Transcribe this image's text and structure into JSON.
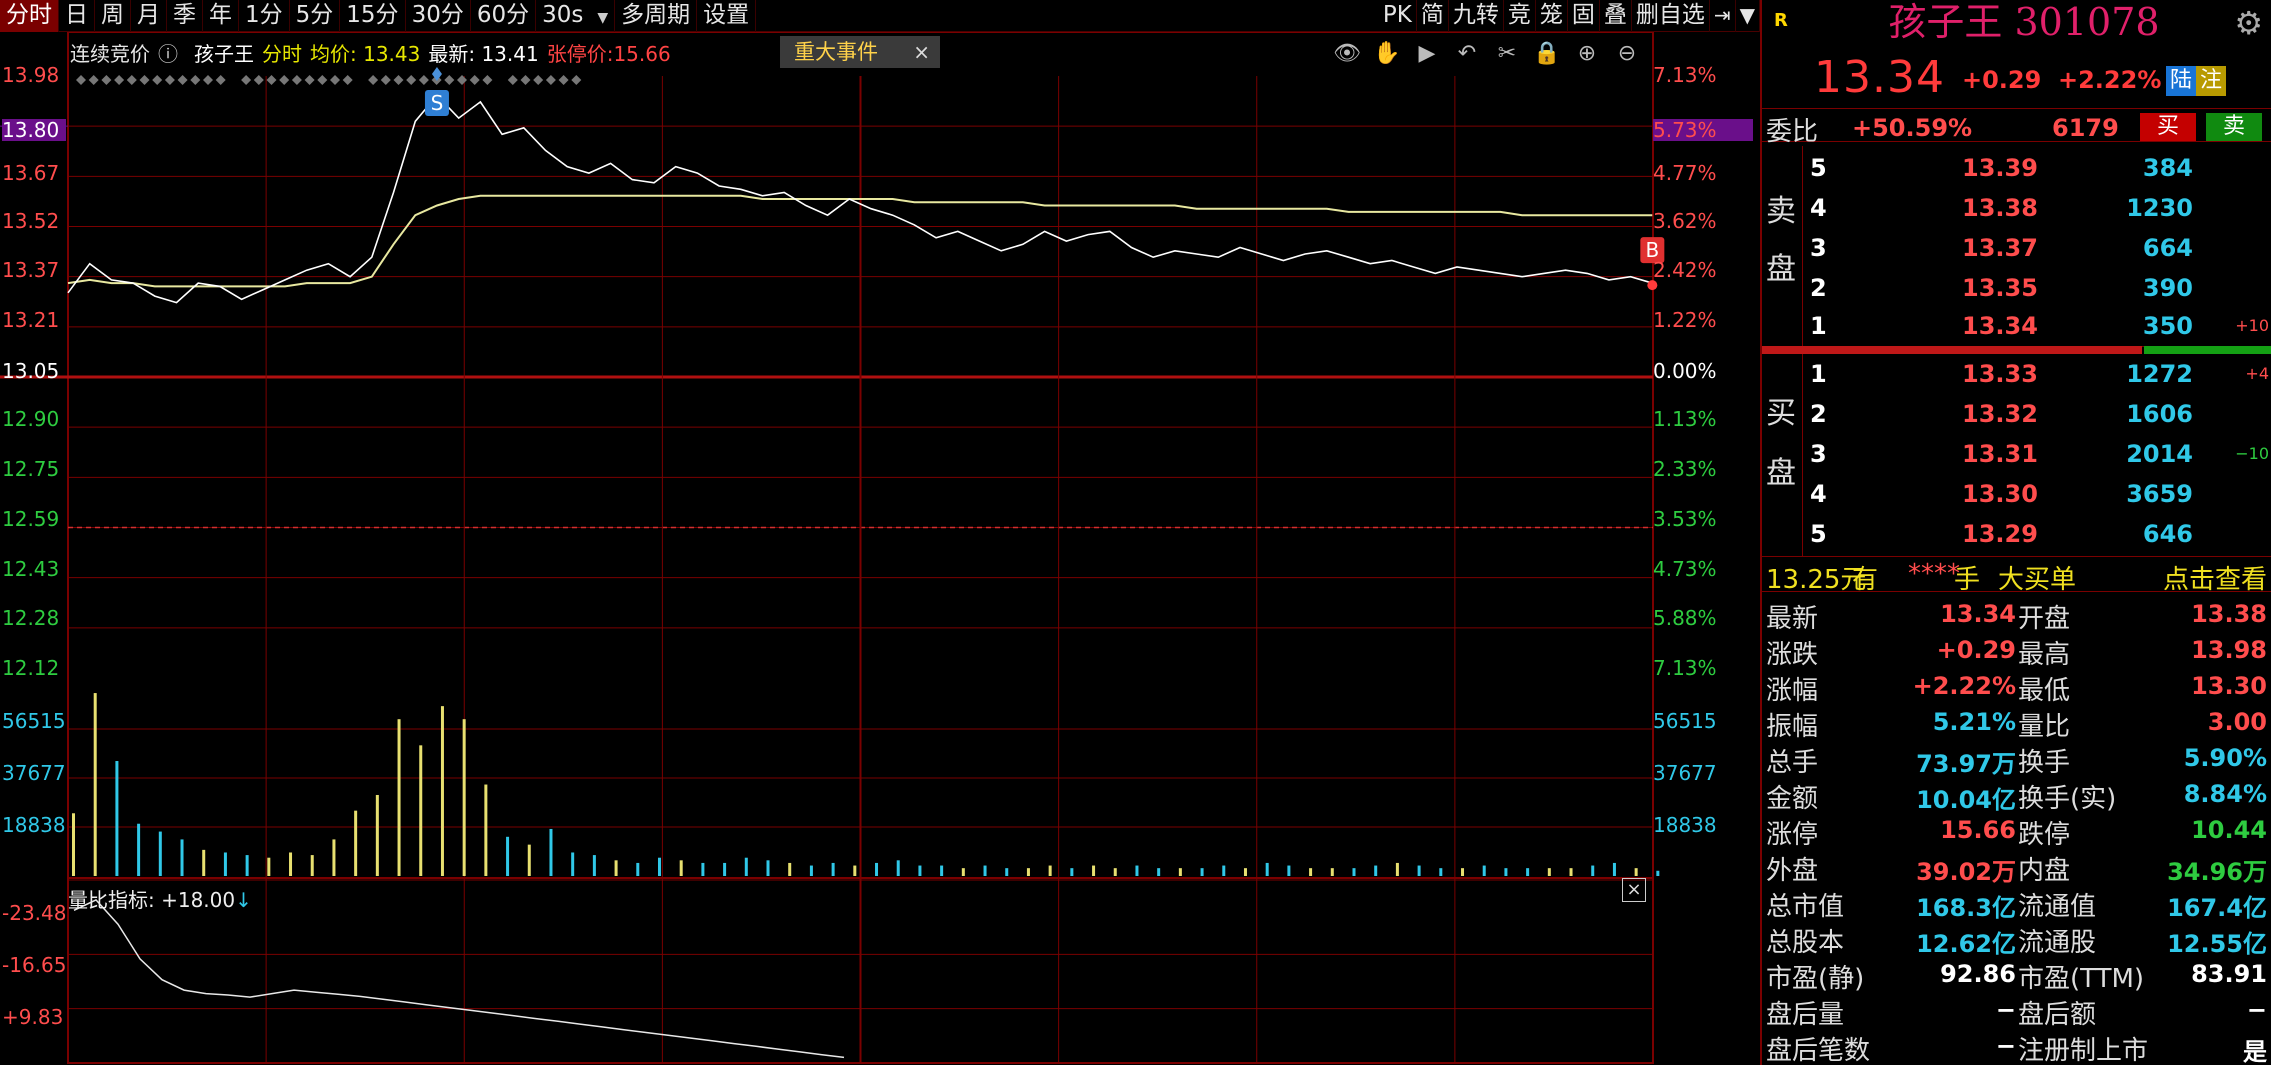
{
  "toolbar": {
    "period_tabs": [
      "分时",
      "日",
      "周",
      "月",
      "季",
      "年",
      "1分",
      "5分",
      "15分",
      "30分",
      "60分"
    ],
    "interval_select": "30s",
    "multi_period": "多周期",
    "settings": "设置",
    "tools": [
      "PK",
      "简",
      "九转",
      "竞",
      "笼",
      "固",
      "叠",
      "删自选"
    ]
  },
  "chart": {
    "info": {
      "auction": "连续竞价",
      "name": "孩子王",
      "mode": "分时",
      "avg": "均价: 13.43",
      "latest": "最新: 13.41",
      "limit_up": "张停价:15.66"
    },
    "event_tag": "重大事件",
    "event_close": "×",
    "tool_icons": [
      "eye-icon",
      "hand-icon",
      "play-icon",
      "undo-icon",
      "scissors-icon",
      "lock-icon",
      "zoom-in-icon",
      "zoom-out-icon"
    ],
    "price_axis_left": [
      "13.98",
      "13.80",
      "13.67",
      "13.52",
      "13.37",
      "13.21",
      "13.05",
      "12.90",
      "12.75",
      "12.59",
      "12.43",
      "12.28",
      "12.12"
    ],
    "price_axis_right": [
      "7.13%",
      "5.73%",
      "4.77%",
      "3.62%",
      "2.42%",
      "1.22%",
      "0.00%",
      "1.13%",
      "2.33%",
      "3.53%",
      "4.73%",
      "5.88%",
      "7.13%"
    ],
    "price_axis_colors": [
      "red",
      "hl",
      "red",
      "red",
      "red",
      "red",
      "white",
      "green",
      "green",
      "green",
      "green",
      "green",
      "green"
    ],
    "volume_axis": [
      "56515",
      "37677",
      "18838"
    ],
    "indicator_label": "量比指标: +18.00",
    "indicator_axis": [
      "-23.48",
      "-16.65",
      "+9.83"
    ],
    "markers": {
      "sell": "S",
      "buy": "B"
    },
    "colors": {
      "up": "#ff4d4d",
      "down": "#2ecc40",
      "grid": "#7a0000",
      "price_line": "#ffffff",
      "avg_line": "#e8e8a0"
    }
  },
  "panel": {
    "r_badge": "R",
    "title": "孩子王 301078",
    "price": "13.34",
    "change": "+0.29",
    "change_pct": "+2.22%",
    "tag1": "陆",
    "tag2": "注",
    "ratio_label": "委比",
    "ratio_value": "+50.59%",
    "ratio_diff": "6179",
    "buy_label": "买",
    "sell_label": "卖",
    "sell_side_label": [
      "卖",
      "盘"
    ],
    "buy_side_label": [
      "买",
      "盘"
    ],
    "asks": [
      {
        "level": "5",
        "price": "13.39",
        "volume": "384",
        "delta": ""
      },
      {
        "level": "4",
        "price": "13.38",
        "volume": "1230",
        "delta": ""
      },
      {
        "level": "3",
        "price": "13.37",
        "volume": "664",
        "delta": ""
      },
      {
        "level": "2",
        "price": "13.35",
        "volume": "390",
        "delta": ""
      },
      {
        "level": "1",
        "price": "13.34",
        "volume": "350",
        "delta": "+10"
      }
    ],
    "bids": [
      {
        "level": "1",
        "price": "13.33",
        "volume": "1272",
        "delta": "+4"
      },
      {
        "level": "2",
        "price": "13.32",
        "volume": "1606",
        "delta": ""
      },
      {
        "level": "3",
        "price": "13.31",
        "volume": "2014",
        "delta": "−10"
      },
      {
        "level": "4",
        "price": "13.30",
        "volume": "3659",
        "delta": ""
      },
      {
        "level": "5",
        "price": "13.29",
        "volume": "646",
        "delta": ""
      }
    ],
    "big_order": {
      "price": "13.25元",
      "have": "有",
      "stars": "****",
      "hand": "手",
      "label": "大买单",
      "link": "点击查看"
    },
    "stats": [
      {
        "l1": "最新",
        "v1": "13.34",
        "c1": "red",
        "l2": "开盘",
        "v2": "13.38",
        "c2": "red"
      },
      {
        "l1": "涨跌",
        "v1": "+0.29",
        "c1": "red",
        "l2": "最高",
        "v2": "13.98",
        "c2": "red"
      },
      {
        "l1": "涨幅",
        "v1": "+2.22%",
        "c1": "red",
        "l2": "最低",
        "v2": "13.30",
        "c2": "red"
      },
      {
        "l1": "振幅",
        "v1": "5.21%",
        "c1": "cyan",
        "l2": "量比",
        "v2": "3.00",
        "c2": "red"
      },
      {
        "l1": "总手",
        "v1": "73.97万",
        "c1": "cyan",
        "l2": "换手",
        "v2": "5.90%",
        "c2": "cyan"
      },
      {
        "l1": "金额",
        "v1": "10.04亿",
        "c1": "cyan",
        "l2": "换手(实)",
        "v2": "8.84%",
        "c2": "cyan"
      },
      {
        "l1": "涨停",
        "v1": "15.66",
        "c1": "red",
        "l2": "跌停",
        "v2": "10.44",
        "c2": "green"
      },
      {
        "l1": "外盘",
        "v1": "39.02万",
        "c1": "red",
        "l2": "内盘",
        "v2": "34.96万",
        "c2": "green"
      },
      {
        "l1": "总市值",
        "v1": "168.3亿",
        "c1": "cyan",
        "l2": "流通值",
        "v2": "167.4亿",
        "c2": "cyan"
      },
      {
        "l1": "总股本",
        "v1": "12.62亿",
        "c1": "cyan",
        "l2": "流通股",
        "v2": "12.55亿",
        "c2": "cyan"
      },
      {
        "l1": "市盈(静)",
        "v1": "92.86",
        "c1": "white",
        "l2": "市盈(TTM)",
        "v2": "83.91",
        "c2": "white"
      },
      {
        "l1": "盘后量",
        "v1": "−",
        "c1": "white",
        "l2": "盘后额",
        "v2": "−",
        "c2": "white"
      },
      {
        "l1": "盘后笔数",
        "v1": "−",
        "c1": "white",
        "l2": "注册制上市",
        "v2": "是",
        "c2": "white"
      }
    ]
  },
  "chart_data": {
    "type": "line",
    "prev_close": 13.05,
    "price": [
      13.31,
      13.4,
      13.35,
      13.34,
      13.3,
      13.28,
      13.34,
      13.33,
      13.29,
      13.32,
      13.35,
      13.38,
      13.4,
      13.36,
      13.42,
      13.62,
      13.84,
      13.92,
      13.85,
      13.9,
      13.8,
      13.82,
      13.75,
      13.7,
      13.68,
      13.71,
      13.66,
      13.65,
      13.7,
      13.68,
      13.64,
      13.63,
      13.61,
      13.62,
      13.58,
      13.55,
      13.6,
      13.57,
      13.55,
      13.52,
      13.48,
      13.5,
      13.47,
      13.44,
      13.46,
      13.5,
      13.47,
      13.49,
      13.5,
      13.45,
      13.42,
      13.44,
      13.43,
      13.42,
      13.45,
      13.43,
      13.41,
      13.43,
      13.44,
      13.42,
      13.4,
      13.41,
      13.39,
      13.37,
      13.39,
      13.38,
      13.37,
      13.36,
      13.37,
      13.38,
      13.37,
      13.35,
      13.36,
      13.34
    ],
    "avg": [
      13.34,
      13.35,
      13.34,
      13.34,
      13.33,
      13.33,
      13.33,
      13.33,
      13.33,
      13.33,
      13.33,
      13.34,
      13.34,
      13.34,
      13.36,
      13.46,
      13.55,
      13.58,
      13.6,
      13.61,
      13.61,
      13.61,
      13.61,
      13.61,
      13.61,
      13.61,
      13.61,
      13.61,
      13.61,
      13.61,
      13.61,
      13.61,
      13.6,
      13.6,
      13.6,
      13.6,
      13.6,
      13.6,
      13.6,
      13.59,
      13.59,
      13.59,
      13.59,
      13.59,
      13.59,
      13.58,
      13.58,
      13.58,
      13.58,
      13.58,
      13.58,
      13.58,
      13.57,
      13.57,
      13.57,
      13.57,
      13.57,
      13.57,
      13.57,
      13.56,
      13.56,
      13.56,
      13.56,
      13.56,
      13.56,
      13.56,
      13.56,
      13.55,
      13.55,
      13.55,
      13.55,
      13.55,
      13.55,
      13.55
    ],
    "volume": [
      24000,
      70000,
      44000,
      20000,
      17000,
      14000,
      10000,
      9000,
      8000,
      7000,
      9000,
      8000,
      14000,
      25000,
      31000,
      60000,
      50000,
      65000,
      60000,
      35000,
      15000,
      12000,
      18000,
      9000,
      8000,
      6000,
      5000,
      7000,
      6000,
      5000,
      5000,
      7000,
      6000,
      5000,
      4000,
      5000,
      4000,
      5000,
      6000,
      4000,
      4000,
      3000,
      4000,
      3000,
      3000,
      4000,
      3000,
      4000,
      3000,
      4000,
      3000,
      3000,
      3000,
      4000,
      3000,
      5000,
      4000,
      3000,
      3000,
      3000,
      4000,
      5000,
      4000,
      3000,
      3000,
      4000,
      3000,
      3000,
      3000,
      3000,
      4000,
      5000,
      3000,
      2000
    ],
    "ratio": [
      22,
      23.5,
      20,
      15,
      12,
      10.5,
      10,
      9.8,
      9.5,
      10,
      10.5,
      10.2,
      9.9,
      9.6,
      9.2,
      8.8,
      8.4,
      8.0,
      7.6,
      7.2,
      6.8,
      6.4,
      6.0,
      5.6,
      5.2,
      4.8,
      4.4,
      4.0,
      3.6,
      3.2,
      2.8,
      2.4,
      2.0,
      1.6,
      1.2,
      0.8
    ],
    "ylim": [
      12.12,
      13.98
    ],
    "volume_max": 75000,
    "ratio_lim": [
      0,
      23.48
    ],
    "sell_marker_index": 17,
    "buy_marker_index": 73
  }
}
